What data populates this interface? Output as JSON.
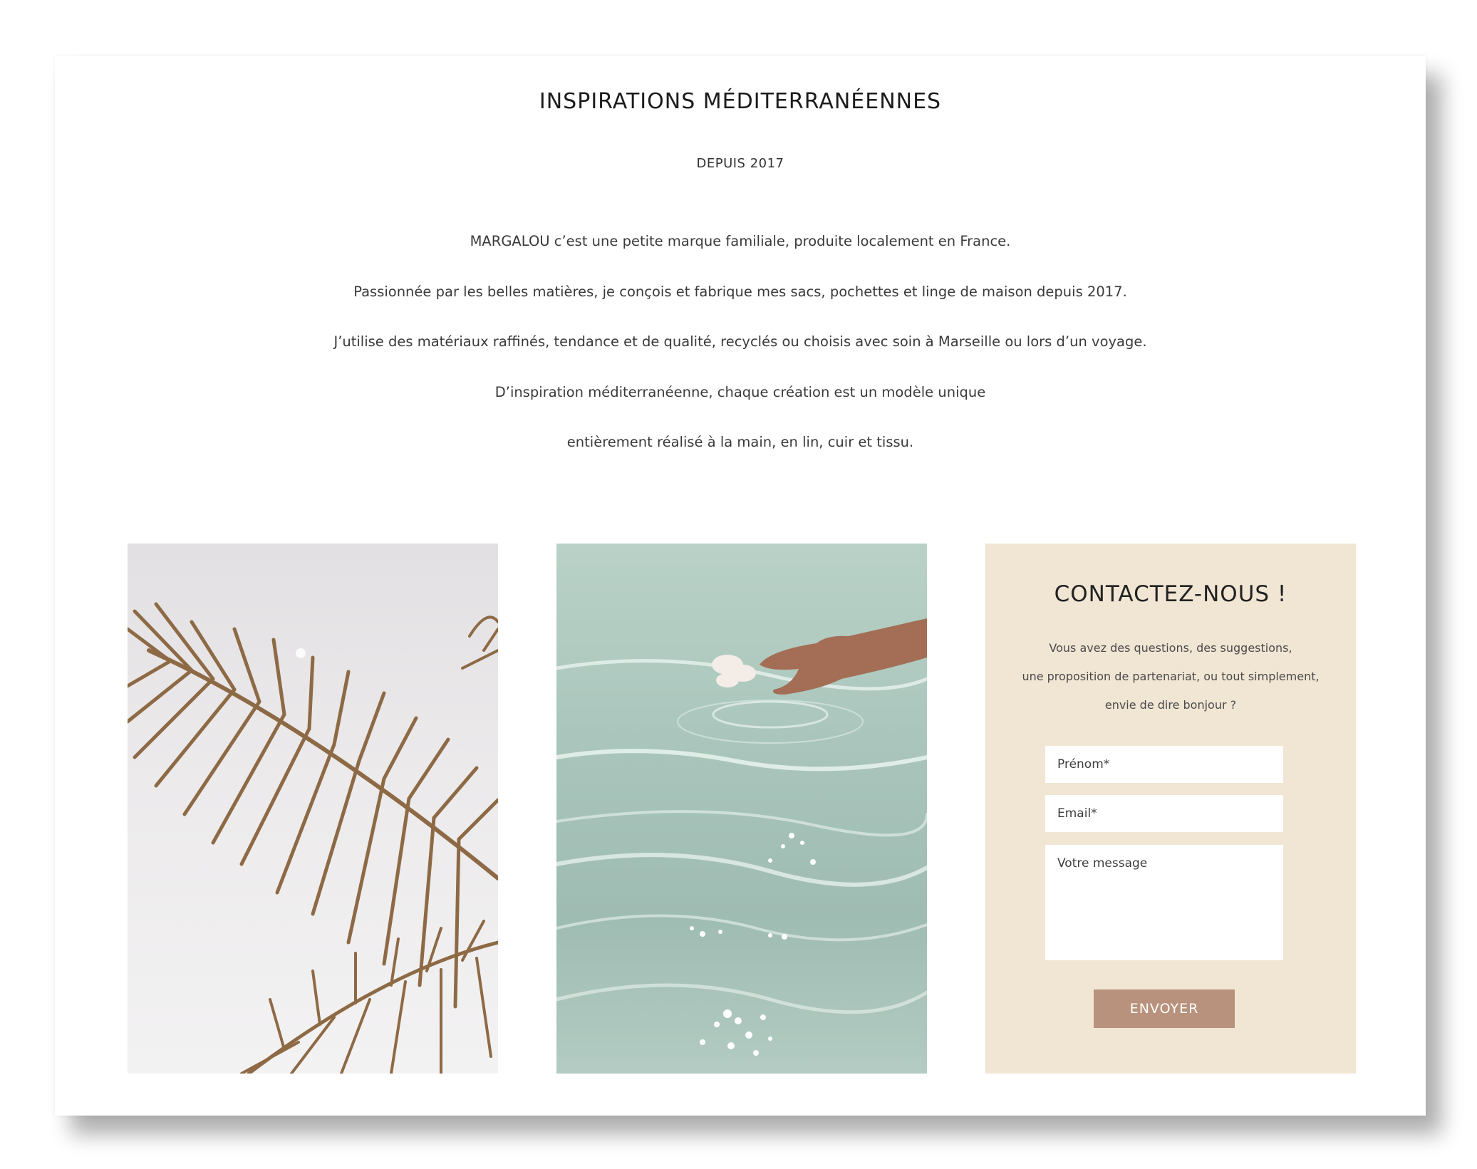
{
  "header": {
    "title": "INSPIRATIONS MÉDITERRANÉENNES",
    "subtitle": "DEPUIS 2017"
  },
  "about": {
    "paragraphs": [
      "MARGALOU c’est une petite marque familiale, produite localement en France.",
      "Passionnée par les belles matières, je conçois et fabrique mes sacs, pochettes et linge de maison depuis 2017.",
      "J’utilise des matériaux raffinés, tendance et de qualité, recyclés ou choisis avec soin à Marseille ou lors d’un voyage.",
      "D’inspiration méditerranéenne, chaque création est un modèle unique",
      "entièrement réalisé à la main, en lin, cuir et tissu."
    ]
  },
  "contact": {
    "title": "CONTACTEZ-NOUS !",
    "text_lines": [
      "Vous avez des questions, des suggestions,",
      "une proposition de partenariat, ou tout simplement,",
      "envie de dire bonjour ?"
    ],
    "firstname_placeholder": "Prénom*",
    "email_placeholder": "Email*",
    "message_placeholder": "Votre message",
    "submit_label": "ENVOYER"
  },
  "colors": {
    "contact_background": "#f1e6d4",
    "button": "#b8927c",
    "text": "#2b2b2b"
  }
}
